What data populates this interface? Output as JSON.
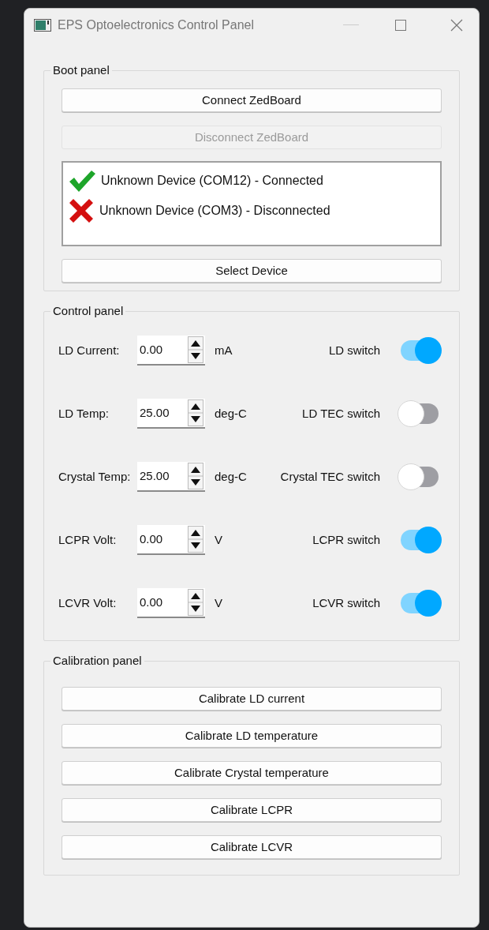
{
  "window": {
    "title": "EPS Optoelectronics Control Panel"
  },
  "boot_panel": {
    "title": "Boot panel",
    "buttons": [
      {
        "label": "Connect ZedBoard",
        "disabled": false
      },
      {
        "label": "Disconnect ZedBoard",
        "disabled": true
      }
    ],
    "devices": [
      {
        "label": "Unknown Device (COM12) - Connected",
        "connected": true
      },
      {
        "label": "Unknown Device (COM3) - Disconnected",
        "connected": false
      }
    ],
    "select_button": {
      "label": "Select Device",
      "disabled": false
    }
  },
  "control_panel": {
    "title": "Control panel",
    "rows": [
      {
        "label": "LD Current:",
        "value": "0.00",
        "unit": "mA",
        "switch_label": "LD switch",
        "on": true
      },
      {
        "label": "LD Temp:",
        "value": "25.00",
        "unit": "deg-C",
        "switch_label": "LD TEC switch",
        "on": false
      },
      {
        "label": "Crystal Temp:",
        "value": "25.00",
        "unit": "deg-C",
        "switch_label": "Crystal TEC switch",
        "on": false
      },
      {
        "label": "LCPR Volt:",
        "value": "0.00",
        "unit": "V",
        "switch_label": "LCPR switch",
        "on": true
      },
      {
        "label": "LCVR Volt:",
        "value": "0.00",
        "unit": "V",
        "switch_label": "LCVR switch",
        "on": true
      }
    ]
  },
  "calibration_panel": {
    "title": "Calibration panel",
    "buttons": [
      {
        "label": "Calibrate LD current"
      },
      {
        "label": "Calibrate LD temperature"
      },
      {
        "label": "Calibrate Crystal temperature"
      },
      {
        "label": "Calibrate LCPR"
      },
      {
        "label": "Calibrate LCVR"
      }
    ]
  }
}
